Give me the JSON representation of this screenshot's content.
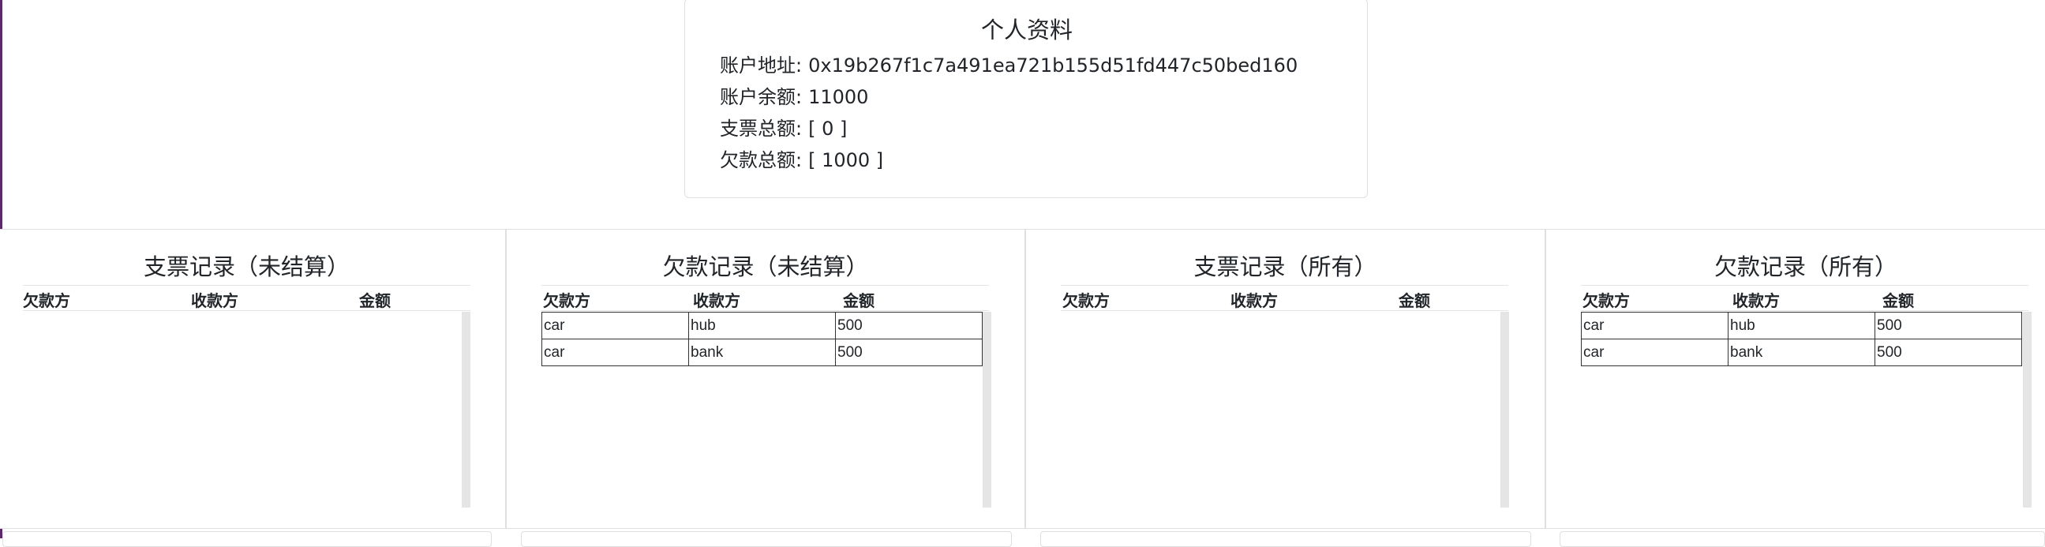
{
  "profile": {
    "title": "个人资料",
    "rows": [
      {
        "label": "账户地址:",
        "value": "0x19b267f1c7a491ea721b155d51fd447c50bed160"
      },
      {
        "label": "账户余额:",
        "value": "11000"
      },
      {
        "label": "支票总额:",
        "value": "[ 0 ]"
      },
      {
        "label": "欠款总额:",
        "value": "[ 1000 ]"
      }
    ]
  },
  "panels": [
    {
      "title": "支票记录（未结算）",
      "headers": [
        "欠款方",
        "收款方",
        "金额"
      ],
      "rows": []
    },
    {
      "title": "欠款记录（未结算）",
      "headers": [
        "欠款方",
        "收款方",
        "金额"
      ],
      "rows": [
        [
          "car",
          "hub",
          "500"
        ],
        [
          "car",
          "bank",
          "500"
        ]
      ]
    },
    {
      "title": "支票记录（所有）",
      "headers": [
        "欠款方",
        "收款方",
        "金额"
      ],
      "rows": []
    },
    {
      "title": "欠款记录（所有）",
      "headers": [
        "欠款方",
        "收款方",
        "金额"
      ],
      "rows": [
        [
          "car",
          "hub",
          "500"
        ],
        [
          "car",
          "bank",
          "500"
        ]
      ]
    }
  ]
}
